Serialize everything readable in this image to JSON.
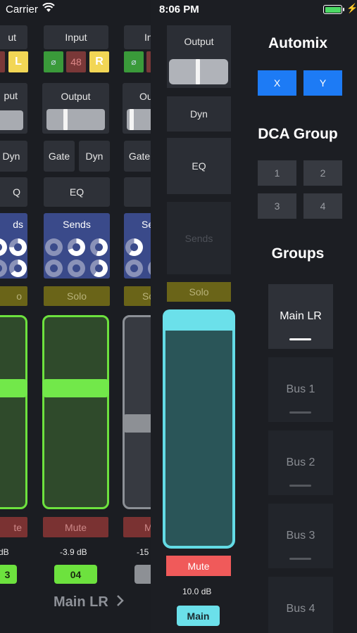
{
  "status_bar": {
    "carrier": "Carrier",
    "time": "8:06 PM"
  },
  "channels": [
    {
      "input_label": "ut",
      "phase": "⌀",
      "phantom": "8",
      "routing": "L",
      "output_label": "put",
      "gate": "",
      "dyn": "Dyn",
      "eq": "Q",
      "sends_label": "ds",
      "solo": "o",
      "mute": "te",
      "db": "dB",
      "number": "3"
    },
    {
      "input_label": "Input",
      "phase": "⌀",
      "phantom": "48",
      "routing": "R",
      "output_label": "Output",
      "gate": "Gate",
      "dyn": "Dyn",
      "eq": "EQ",
      "sends_label": "Sends",
      "solo": "Solo",
      "mute": "Mute",
      "db": "-3.9 dB",
      "number": "04",
      "pan_position": 0.5,
      "fader_level": 0.7
    },
    {
      "input_label": "In",
      "phase": "⌀",
      "phantom": "",
      "routing": "",
      "output_label": "Ou",
      "gate": "Gate",
      "dyn": "",
      "eq": "",
      "sends_label": "Se",
      "solo": "So",
      "mute": "M",
      "db": "-15",
      "number": ""
    }
  ],
  "bus_label": "Main LR",
  "bus_chevron": "chevron-right-icon",
  "master": {
    "output_label": "Output",
    "dyn": "Dyn",
    "eq": "EQ",
    "sends": "Sends",
    "solo": "Solo",
    "mute": "Mute",
    "db": "10.0 dB",
    "name": "Main"
  },
  "panel": {
    "automix_title": "Automix",
    "automix_buttons": [
      "X",
      "Y"
    ],
    "dca_title": "DCA Group",
    "dca_buttons": [
      "1",
      "2",
      "3",
      "4"
    ],
    "groups_title": "Groups",
    "groups": [
      "Main LR",
      "Bus 1",
      "Bus 2",
      "Bus 3",
      "Bus 4"
    ],
    "active_group": "Main LR"
  },
  "colors": {
    "accent_green": "#6de23e",
    "accent_cyan": "#6be0ea",
    "accent_blue": "#1d7bf5",
    "mute_red": "#f05a5a",
    "sends_blue": "#3a4a8a"
  }
}
